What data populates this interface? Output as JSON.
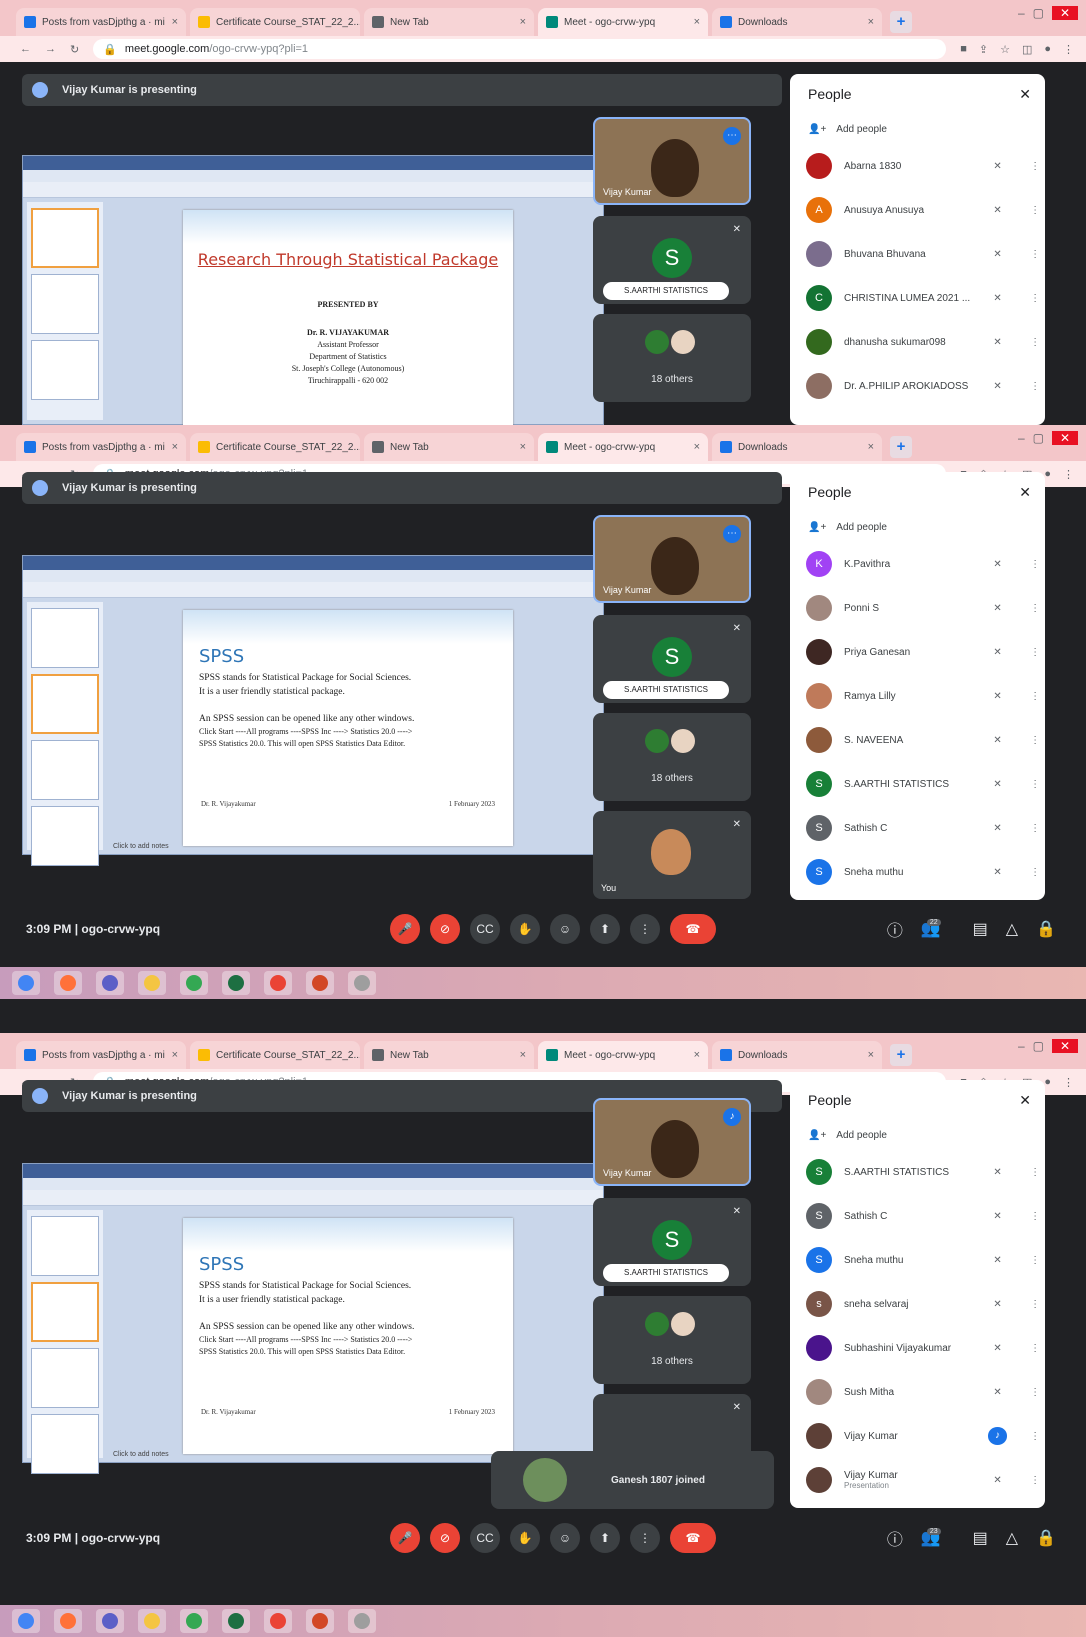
{
  "browser": {
    "tabs": [
      {
        "label": "Posts from vasDjpthg a · mi",
        "color": "#1a73e8"
      },
      {
        "label": "Certificate Course_STAT_22_2...",
        "color": "#fbbc04"
      },
      {
        "label": "New Tab",
        "color": "#5f6368"
      },
      {
        "label": "Meet - ogo-crvw-ypq",
        "color": "#00897b"
      },
      {
        "label": "Downloads",
        "color": "#1a73e8"
      }
    ],
    "url_host": "meet.google.com",
    "url_path": "/ogo-crvw-ypq?pli=1"
  },
  "presenting_banner": "Vijay Kumar is presenting",
  "slides": {
    "s1": {
      "title": "Research Through Statistical Package",
      "presented_by": "PRESENTED BY",
      "author": "Dr. R. VIJAYAKUMAR",
      "role": "Assistant Professor",
      "dept": "Department of Statistics",
      "college": "St. Joseph's College (Autonomous)",
      "city": "Tiruchirappalli - 620 002"
    },
    "s2": {
      "heading": "SPSS",
      "line1": "SPSS stands for Statistical Package for Social Sciences.",
      "line2": "It is a user friendly statistical package.",
      "line3": "An SPSS session can be opened like any other windows.",
      "line4": "Click Start ----All programs ----SPSS Inc ----> Statistics 20.0 ---->",
      "line5": "SPSS Statistics 20.0. This will open SPSS Statistics Data Editor.",
      "footer_left": "Dr. R. Vijayakumar",
      "footer_right": "1 February 2023",
      "notes": "Click to add notes"
    }
  },
  "tiles": {
    "presenter_name": "Vijay Kumar",
    "sarthi": "S.AARTHI STATISTICS",
    "sarthi_letter": "S",
    "others": "18 others",
    "you": "You"
  },
  "people_panel": {
    "title": "People",
    "add": "Add people",
    "list1": [
      {
        "name": "Abarna 1830",
        "letter": "",
        "color": "#b71c1c"
      },
      {
        "name": "Anusuya Anusuya",
        "letter": "A",
        "color": "#e8710a"
      },
      {
        "name": "Bhuvana Bhuvana",
        "letter": "",
        "color": "#7b6d8d"
      },
      {
        "name": "CHRISTINA LUMEA 2021 ...",
        "letter": "C",
        "color": "#137333"
      },
      {
        "name": "dhanusha sukumar098",
        "letter": "",
        "color": "#33691e"
      },
      {
        "name": "Dr. A.PHILIP AROKIADOSS",
        "letter": "",
        "color": "#8d6e63"
      }
    ],
    "list2": [
      {
        "name": "K.Pavithra",
        "letter": "K",
        "color": "#a142f4"
      },
      {
        "name": "Ponni S",
        "letter": "",
        "color": "#a1887f"
      },
      {
        "name": "Priya Ganesan",
        "letter": "",
        "color": "#3e2723"
      },
      {
        "name": "Ramya Lilly",
        "letter": "",
        "color": "#bf7a5a"
      },
      {
        "name": "S. NAVEENA",
        "letter": "",
        "color": "#8d5a3b"
      },
      {
        "name": "S.AARTHI STATISTICS",
        "letter": "S",
        "color": "#188038"
      },
      {
        "name": "Sathish C",
        "letter": "S",
        "color": "#5f6368"
      },
      {
        "name": "Sneha muthu",
        "letter": "S",
        "color": "#1a73e8"
      }
    ],
    "list3": [
      {
        "name": "S.AARTHI STATISTICS",
        "letter": "S",
        "color": "#188038",
        "sub": ""
      },
      {
        "name": "Sathish C",
        "letter": "S",
        "color": "#5f6368",
        "sub": ""
      },
      {
        "name": "Sneha muthu",
        "letter": "S",
        "color": "#1a73e8",
        "sub": ""
      },
      {
        "name": "sneha selvaraj",
        "letter": "s",
        "color": "#795548",
        "sub": ""
      },
      {
        "name": "Subhashini Vijayakumar",
        "letter": "",
        "color": "#4a148c",
        "sub": ""
      },
      {
        "name": "Sush Mitha",
        "letter": "",
        "color": "#a1887f",
        "sub": ""
      },
      {
        "name": "Vijay Kumar",
        "letter": "",
        "color": "#5d4037",
        "sub": "",
        "speaking": true
      },
      {
        "name": "Vijay Kumar",
        "letter": "",
        "color": "#5d4037",
        "sub": "Presentation"
      }
    ]
  },
  "controls": {
    "time": "3:09 PM",
    "meeting_code": "ogo-crvw-ypq",
    "participants_count_2": "22",
    "participants_count_3": "23"
  },
  "toast": "Ganesh 1807 joined"
}
